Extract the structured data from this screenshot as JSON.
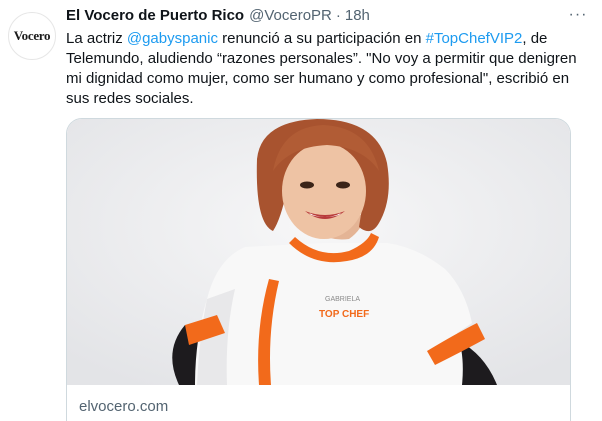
{
  "tweet": {
    "avatar_text": "Vocero",
    "display_name": "El Vocero de Puerto Rico",
    "handle": "@VoceroPR",
    "separator": "·",
    "time": "18h",
    "more_label": "···",
    "text_parts": [
      "La actriz ",
      "@gabyspanic",
      " renunció a su participación en  ",
      "#TopChefVIP2",
      ", de Telemundo, aludiendo “razones personales”. \"No voy a permitir que denigren mi dignidad como mujer, como ser humano y como profesional\", escribió en sus redes sociales."
    ]
  },
  "card": {
    "image_name": "TOP CHEF",
    "jacket_name": "GABRIELA",
    "domain": "elvocero.com"
  },
  "colors": {
    "link": "#1d9bf0",
    "text": "#0f1419",
    "secondary": "#536471",
    "border": "#cfd9de",
    "accent_orange": "#f26a1b"
  }
}
